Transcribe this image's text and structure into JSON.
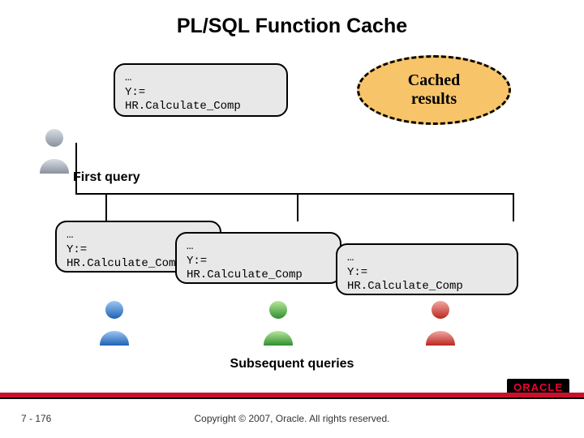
{
  "title": "PL/SQL Function Cache",
  "code_snippet": {
    "line1": "…",
    "line2": "Y:=",
    "line3": "HR.Calculate_Comp"
  },
  "cached_label": "Cached\nresults",
  "first_query_label": "First query",
  "subsequent_label": "Subsequent queries",
  "footer": {
    "slide_number": "7 - 176",
    "copyright": "Copyright © 2007, Oracle. All rights reserved.",
    "logo": "ORACLE"
  },
  "avatars": {
    "initial": "gray",
    "subsequent": [
      "blue",
      "green",
      "red"
    ]
  }
}
